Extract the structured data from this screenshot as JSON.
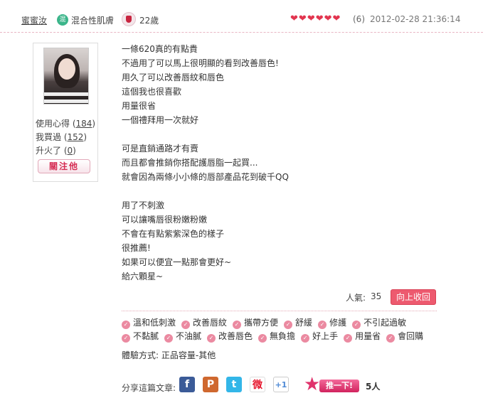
{
  "header": {
    "username": "蜜蜜汝",
    "skin_badge": "混",
    "skin_type": "混合性肌膚",
    "age": "22歲",
    "rating_hearts": 6,
    "rating_count": "(6)",
    "datetime": "2012-02-28 21:36:14",
    "heart_color": "#e2354f"
  },
  "sidebar": {
    "stats": [
      {
        "label": "使用心得",
        "value": "184"
      },
      {
        "label": "我買過",
        "value": "152"
      },
      {
        "label": "升火了",
        "value": "0"
      }
    ],
    "follow_label": "關注他"
  },
  "review": {
    "lines": [
      "一條620真的有點貴",
      "不過用了可以馬上很明顯的看到改善唇色!",
      "用久了可以改善唇紋和唇色",
      "這個我也很喜歡",
      "用量很省",
      "一個禮拜用一次就好",
      "",
      "可是直銷通路才有賣",
      "而且都會推銷你搭配護唇脂一起買...",
      "就會因為兩條小小條的唇部產品花到破千QQ",
      "",
      "用了不刺激",
      "可以讓嘴唇很粉嫩粉嫩",
      "不會在有點紫紫深色的樣子",
      "很推薦!",
      "如果可以便宜一點那會更好~",
      "給六顆星~"
    ]
  },
  "popularity": {
    "label": "人氣:",
    "value": "35"
  },
  "collect_label": "向上收回",
  "tags": [
    "溫和低刺激",
    "改善唇紋",
    "攜帶方便",
    "舒緩",
    "修護",
    "不引起過敏",
    "不黏膩",
    "不油膩",
    "改善唇色",
    "無負擔",
    "好上手",
    "用量省",
    "會回購"
  ],
  "experience": "體驗方式: 正品容量-其他",
  "share": {
    "label": "分享這篇文章:",
    "icons": {
      "facebook": "f",
      "plurk": "P",
      "twitter": "t",
      "weibo": "微",
      "gplus": "+1"
    },
    "push_label": "推一下!",
    "push_count": "5人"
  },
  "colors": {
    "accent": "#ed5a6f",
    "tag_check": "#eb8aa1"
  }
}
